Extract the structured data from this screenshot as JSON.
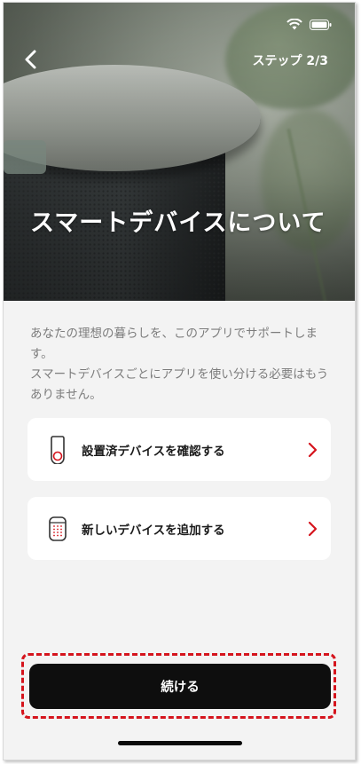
{
  "header": {
    "step_label": "ステップ 2/3",
    "title": "スマートデバイスについて"
  },
  "intro": {
    "text": "あなたの理想の暮らしを、このアプリでサポートします。\nスマートデバイスごとにアプリを使い分ける必要はもうありません。"
  },
  "options": [
    {
      "label": "設置済デバイスを確認する",
      "icon": "installed-device-icon"
    },
    {
      "label": "新しいデバイスを追加する",
      "icon": "speaker-device-icon"
    }
  ],
  "cta": {
    "label": "続ける"
  },
  "colors": {
    "accent": "#d5141d",
    "button": "#0e0e0e",
    "background": "#f3f3f3"
  }
}
